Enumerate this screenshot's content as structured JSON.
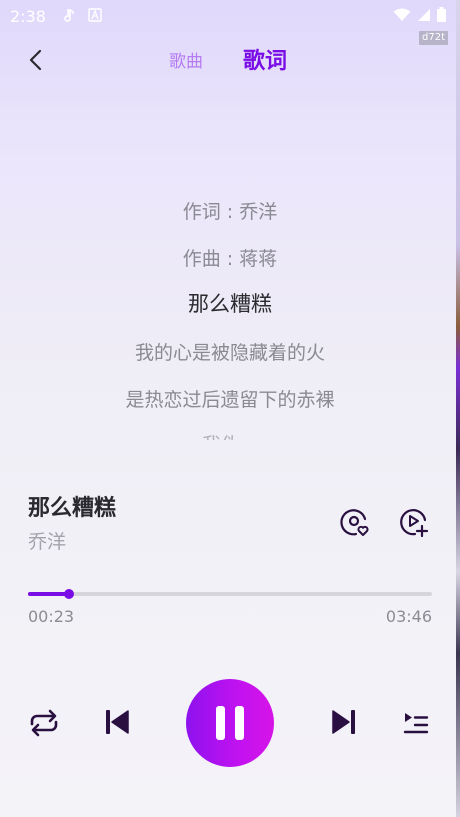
{
  "status_bar": {
    "time": "2:38",
    "icons": [
      "music-note-icon",
      "app-a-icon",
      "wifi-icon",
      "signal-icon",
      "battery-icon"
    ]
  },
  "debug_tag": "d72t",
  "header": {
    "tabs": [
      {
        "label": "歌曲",
        "active": false
      },
      {
        "label": "歌词",
        "active": true
      }
    ]
  },
  "lyrics": {
    "lines": [
      "作词 : 乔洋",
      "作曲 : 蒋蒋",
      "那么糟糕",
      "我的心是被隐藏着的火",
      "是热恋过后遗留下的赤裸",
      "我伪..."
    ],
    "current_index": 2
  },
  "song": {
    "title": "那么糟糕",
    "artist": "乔洋"
  },
  "progress": {
    "current": "00:23",
    "total": "03:46",
    "fraction": 0.101
  },
  "colors": {
    "accent": "#7a0ce6",
    "accent_light": "#b57bf0",
    "play_gradient_start": "#8e12ee",
    "play_gradient_end": "#d614e8"
  }
}
